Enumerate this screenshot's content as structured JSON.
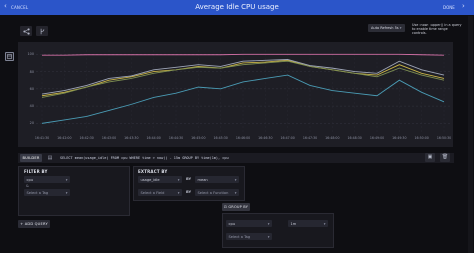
{
  "header": {
    "cancel_label": "CANCEL",
    "title": "Average Idle CPU usage",
    "done_label": "DONE",
    "chevron_left": "‹",
    "chevron_right": "›"
  },
  "toolbar": {
    "share_icon": "share-icon",
    "branch_icon": "branch-icon",
    "side_icon": "window-icon",
    "refresh_label": "Auto Refresh 5s",
    "note": "Use :now: :upper() in a query to enable time range controls."
  },
  "chart_data": {
    "type": "line",
    "ylabels": [
      "100",
      "80",
      "60",
      "40",
      "20"
    ],
    "ylim": [
      10,
      105
    ],
    "x": [
      "16:41:30",
      "16:42:00",
      "16:42:30",
      "16:43:00",
      "16:43:30",
      "16:44:00",
      "16:44:30",
      "16:45:00",
      "16:45:30",
      "16:46:00",
      "16:46:30",
      "16:47:00",
      "16:47:30",
      "16:48:00",
      "16:48:30",
      "16:49:00",
      "16:49:30",
      "16:50:00",
      "16:50:30"
    ],
    "grid": true,
    "series": [
      {
        "color": "#d26fa5",
        "values": [
          99,
          99,
          99.5,
          99.5,
          99.5,
          99.5,
          99.5,
          99.5,
          99.5,
          100,
          100,
          100,
          100,
          100,
          100,
          100,
          100,
          99.5,
          99
        ]
      },
      {
        "color": "#c9b447",
        "values": [
          52,
          56,
          62,
          70,
          74,
          80,
          82,
          86,
          84,
          90,
          91,
          93,
          86,
          82,
          78,
          76,
          88,
          78,
          72
        ]
      },
      {
        "color": "#7e8f52",
        "values": [
          50,
          55,
          62,
          68,
          72,
          78,
          82,
          85,
          84,
          88,
          90,
          92,
          86,
          82,
          78,
          74,
          84,
          76,
          70
        ]
      },
      {
        "color": "#9fa6b8",
        "values": [
          54,
          58,
          64,
          72,
          75,
          82,
          85,
          88,
          86,
          92,
          93,
          94,
          87,
          84,
          80,
          78,
          92,
          82,
          76
        ]
      },
      {
        "color": "#4a9bb4",
        "values": [
          20,
          24,
          28,
          35,
          42,
          50,
          55,
          62,
          60,
          68,
          72,
          76,
          64,
          58,
          55,
          52,
          70,
          56,
          45
        ]
      }
    ]
  },
  "query": {
    "builder_label": "BUILDER",
    "code_icon": "code-icon",
    "text": "SELECT mean(usage_idle) FROM cpu WHERE time > now() - 15m GROUP BY time(1m), cpu",
    "copy_icon": "copy-icon",
    "delete_icon": "trash-icon"
  },
  "filter": {
    "label": "FILTER BY",
    "measurement": "cpu",
    "tag_placeholder": "Select a Tag"
  },
  "extract": {
    "label": "EXTRACT BY",
    "field": "usage_idle",
    "by": "BY",
    "fn": "mean",
    "field2_placeholder": "Select a Field",
    "fn2_placeholder": "Select a Function"
  },
  "groupby": {
    "button_label": "⊡ GROUP BY",
    "tag_value": "cpu",
    "interval": "1m",
    "tag_placeholder": "Select a Tag"
  },
  "add_query_label": "+ ADD QUERY"
}
